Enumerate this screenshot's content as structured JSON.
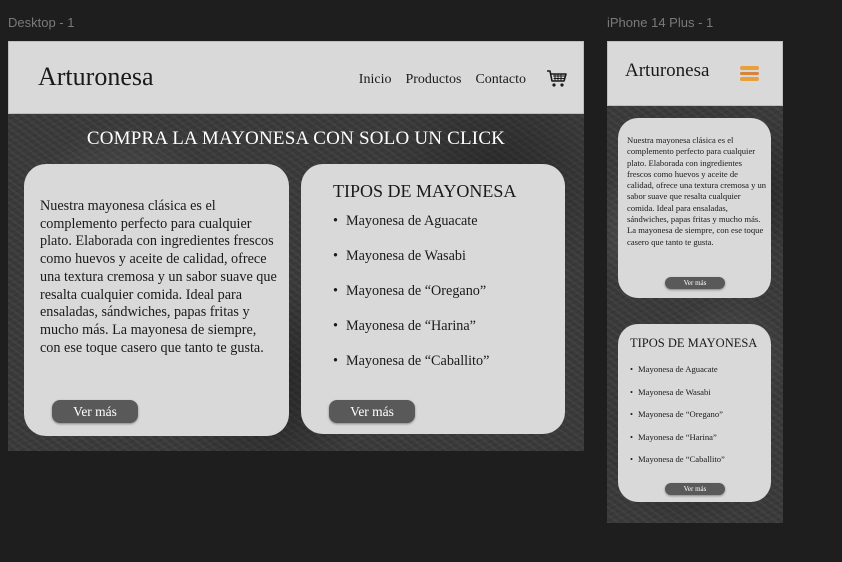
{
  "frames": {
    "desktop_label": "Desktop - 1",
    "mobile_label": "iPhone 14 Plus - 1"
  },
  "brand": "Arturonesa",
  "nav": [
    "Inicio",
    "Productos",
    "Contacto"
  ],
  "icons": {
    "cart": "shopping-cart-icon",
    "menu": "hamburger-menu-icon"
  },
  "hero_title": "COMPRA LA MAYONESA CON SOLO UN CLICK",
  "description": "Nuestra mayonesa clásica es el complemento perfecto para cualquier plato. Elaborada con ingredientes frescos como huevos y aceite de calidad, ofrece una textura cremosa y un sabor suave que resalta cualquier comida. Ideal para ensaladas, sándwiches, papas fritas y mucho más. La mayonesa de siempre, con ese toque casero que tanto te gusta.",
  "types_title": "TIPOS DE MAYONESA",
  "types": [
    "Mayonesa de Aguacate",
    "Mayonesa de Wasabi",
    "Mayonesa de “Oregano”",
    "Mayonesa de “Harina”",
    "Mayonesa de “Caballito”"
  ],
  "button_label": "Ver más",
  "colors": {
    "canvas": "#1e1e1e",
    "header": "#d9d9d9",
    "card": "#d9d9d9",
    "button": "#595959",
    "menu_icon": "#e8a13a"
  }
}
